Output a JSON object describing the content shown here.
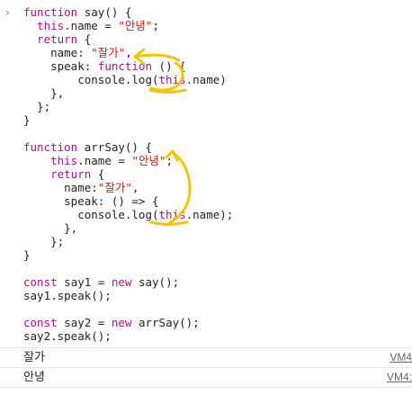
{
  "console": {
    "prompt_symbol": "›",
    "code_lines": [
      [
        {
          "t": "kw",
          "v": "function"
        },
        {
          "t": "fn",
          "v": " say() {"
        }
      ],
      [
        {
          "t": "kw",
          "v": "  this"
        },
        {
          "t": "fn",
          "v": ".name = "
        },
        {
          "t": "str",
          "v": "\"안녕\""
        },
        {
          "t": "fn",
          "v": ";"
        }
      ],
      [
        {
          "t": "kw",
          "v": "  return"
        },
        {
          "t": "fn",
          "v": " {"
        }
      ],
      [
        {
          "t": "fn",
          "v": "    name: "
        },
        {
          "t": "str",
          "v": "\"잘가\""
        },
        {
          "t": "fn",
          "v": ","
        }
      ],
      [
        {
          "t": "fn",
          "v": "    speak: "
        },
        {
          "t": "kw",
          "v": "function"
        },
        {
          "t": "fn",
          "v": " () {"
        }
      ],
      [
        {
          "t": "fn",
          "v": "        console.log("
        },
        {
          "t": "kw",
          "v": "this"
        },
        {
          "t": "fn",
          "v": ".name)"
        }
      ],
      [
        {
          "t": "fn",
          "v": "    },"
        }
      ],
      [
        {
          "t": "fn",
          "v": "  };"
        }
      ],
      [
        {
          "t": "fn",
          "v": "}"
        }
      ],
      [
        {
          "t": "fn",
          "v": ""
        }
      ],
      [
        {
          "t": "kw",
          "v": "function"
        },
        {
          "t": "fn",
          "v": " arrSay() {"
        }
      ],
      [
        {
          "t": "kw",
          "v": "    this"
        },
        {
          "t": "fn",
          "v": ".name = "
        },
        {
          "t": "str",
          "v": "\"안녕\""
        },
        {
          "t": "fn",
          "v": ";"
        }
      ],
      [
        {
          "t": "kw",
          "v": "    return"
        },
        {
          "t": "fn",
          "v": " {"
        }
      ],
      [
        {
          "t": "fn",
          "v": "      name:"
        },
        {
          "t": "str",
          "v": "\"잘가\""
        },
        {
          "t": "fn",
          "v": ","
        }
      ],
      [
        {
          "t": "fn",
          "v": "      speak: () => {"
        }
      ],
      [
        {
          "t": "fn",
          "v": "        console.log("
        },
        {
          "t": "kw",
          "v": "this"
        },
        {
          "t": "fn",
          "v": ".name);"
        }
      ],
      [
        {
          "t": "fn",
          "v": "      },"
        }
      ],
      [
        {
          "t": "fn",
          "v": "    };"
        }
      ],
      [
        {
          "t": "fn",
          "v": "}"
        }
      ],
      [
        {
          "t": "fn",
          "v": ""
        }
      ],
      [
        {
          "t": "kw",
          "v": "const"
        },
        {
          "t": "fn",
          "v": " say1 = "
        },
        {
          "t": "kw",
          "v": "new"
        },
        {
          "t": "fn",
          "v": " say();"
        }
      ],
      [
        {
          "t": "fn",
          "v": "say1.speak();"
        }
      ],
      [
        {
          "t": "fn",
          "v": ""
        }
      ],
      [
        {
          "t": "kw",
          "v": "const"
        },
        {
          "t": "fn",
          "v": " say2 = "
        },
        {
          "t": "kw",
          "v": "new"
        },
        {
          "t": "fn",
          "v": " arrSay();"
        }
      ],
      [
        {
          "t": "fn",
          "v": "say2.speak();"
        }
      ]
    ],
    "logs": [
      {
        "text": "잘가",
        "source": "VM4"
      },
      {
        "text": "안녕",
        "source": "VM4:"
      }
    ]
  },
  "colors": {
    "keyword": "#aa0d91",
    "string": "#c41a16",
    "annotation": "#f5c400"
  }
}
